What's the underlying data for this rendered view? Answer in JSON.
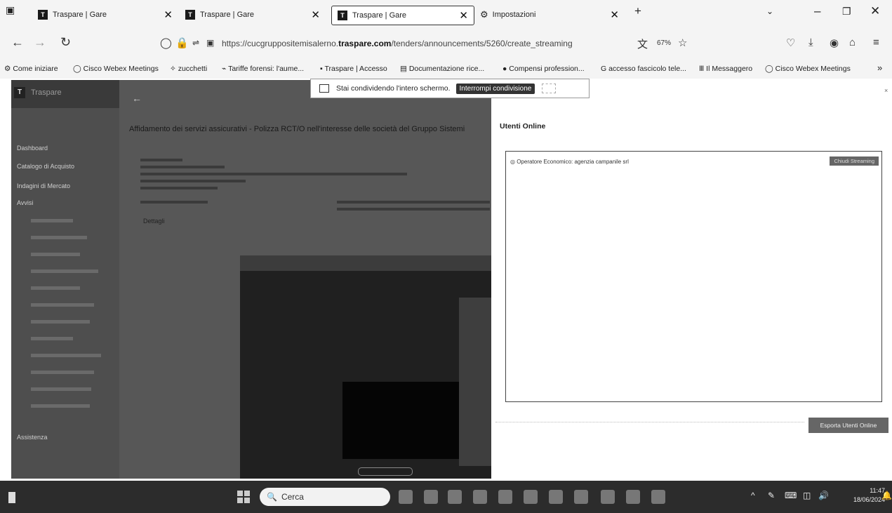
{
  "tabs": [
    {
      "label": "Traspare | Gare",
      "icon": "traspare-icon"
    },
    {
      "label": "Traspare | Gare",
      "icon": "traspare-icon"
    },
    {
      "label": "Traspare | Gare",
      "icon": "traspare-icon",
      "active": true
    },
    {
      "label": "Impostazioni",
      "icon": "gear-icon"
    }
  ],
  "address": {
    "url_prefix": "https://cucgruppositemisalerno.",
    "url_domain": "traspare.com",
    "url_path": "/tenders/announcements/5260/create_streaming",
    "zoom": "67%"
  },
  "bookmarks": [
    "Come iniziare",
    "Cisco Webex Meetings",
    "zucchetti",
    "Tariffe forensi: l'aume...",
    "Traspare | Accesso",
    "Documentazione rice...",
    "Compensi profession...",
    "accesso fascicolo tele...",
    "Il Messaggero",
    "Cisco Webex Meetings"
  ],
  "share_banner": {
    "text": "Stai condividendo l'intero schermo.",
    "stop_label": "Interrompi condivisione"
  },
  "sidebar": {
    "brand": "Traspare",
    "items": [
      "Dashboard",
      "Catalogo di Acquisto",
      "Indagini di Mercato",
      "Avvisi",
      "Assistenza"
    ]
  },
  "page": {
    "title": "Affidamento dei servizi assicurativi - Polizza RCT/O nell'interesse delle società del Gruppo Sistemi",
    "details_label": "Dettagli"
  },
  "online": {
    "title": "Utenti Online",
    "user": "Operatore Economico: agenzia campanile srl",
    "user_button": "Chiudi Streaming",
    "export_button": "Esporta Utenti Online"
  },
  "taskbar": {
    "search": "Cerca",
    "time": "11:47",
    "date": "18/06/2024"
  }
}
